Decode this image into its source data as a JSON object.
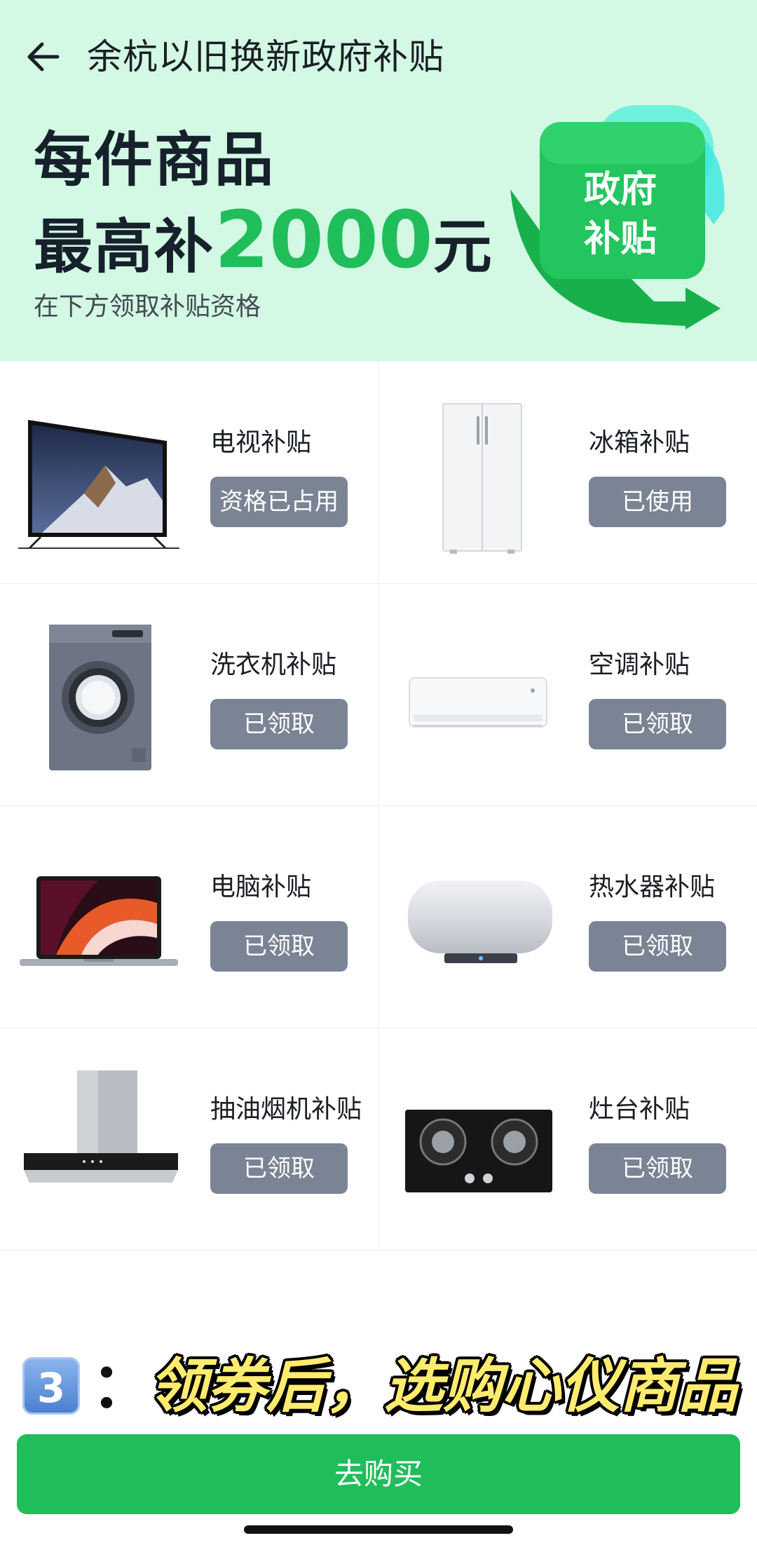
{
  "header": {
    "title": "余杭以旧换新政府补贴",
    "back_icon": "arrow-left-icon"
  },
  "hero": {
    "line1": "每件商品",
    "line2_prefix": "最高补",
    "amount": "2000",
    "line2_suffix": "元",
    "subtitle": "在下方领取补贴资格",
    "badge_line1": "政府",
    "badge_line2": "补贴",
    "accent_color": "#1fbe5a",
    "background_color": "#d3f9e5"
  },
  "grid": {
    "items": [
      {
        "title": "电视补贴",
        "button": "资格已占用",
        "image": "tv"
      },
      {
        "title": "冰箱补贴",
        "button": "已使用",
        "image": "fridge"
      },
      {
        "title": "洗衣机补贴",
        "button": "已领取",
        "image": "washing-machine"
      },
      {
        "title": "空调补贴",
        "button": "已领取",
        "image": "air-conditioner"
      },
      {
        "title": "电脑补贴",
        "button": "已领取",
        "image": "laptop"
      },
      {
        "title": "热水器补贴",
        "button": "已领取",
        "image": "water-heater"
      },
      {
        "title": "抽油烟机补贴",
        "button": "已领取",
        "image": "range-hood"
      },
      {
        "title": "灶台补贴",
        "button": "已领取",
        "image": "gas-stove"
      }
    ],
    "button_color": "#7b8494"
  },
  "caption": {
    "number": "3",
    "colon": "：",
    "text": "领券后，选购心仪商品"
  },
  "footer": {
    "buy_label": "去购买"
  }
}
